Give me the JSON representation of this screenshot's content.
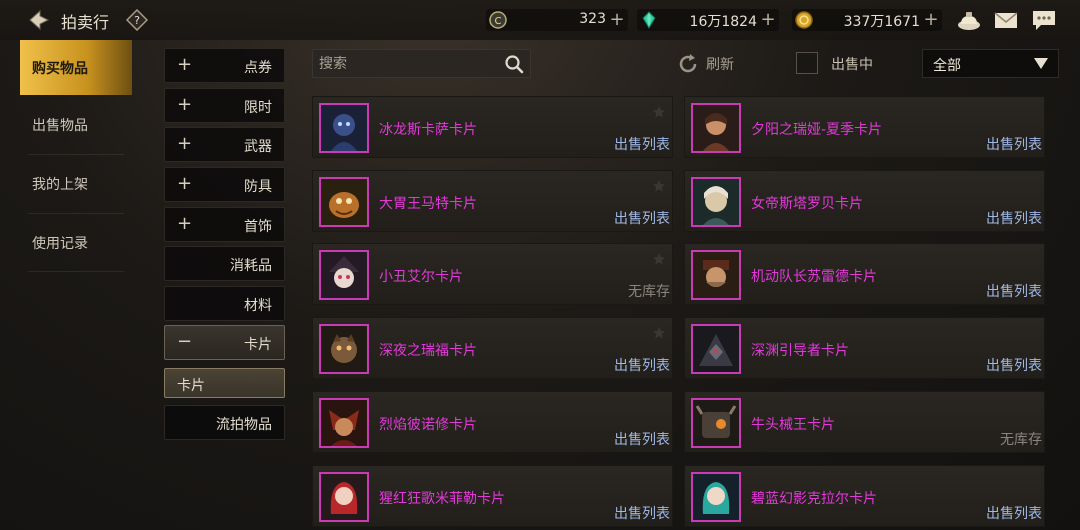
{
  "app": {
    "title": "拍卖行"
  },
  "currencies": [
    {
      "icon": "coin-c-icon",
      "value": "323"
    },
    {
      "icon": "gem-icon",
      "value": "16万1824"
    },
    {
      "icon": "gold-icon",
      "value": "337万1671"
    }
  ],
  "colors": {
    "accent_gold": "#f0c14a",
    "rarity_purple": "#e23ad8",
    "status_blue": "#9fb8e6",
    "status_gray": "#8a857c"
  },
  "nav": {
    "items": [
      {
        "label": "购买物品",
        "active": true
      },
      {
        "label": "出售物品",
        "active": false
      },
      {
        "label": "我的上架",
        "active": false
      },
      {
        "label": "使用记录",
        "active": false
      }
    ]
  },
  "categories": [
    {
      "sign": "+",
      "label": "点券"
    },
    {
      "sign": "+",
      "label": "限时"
    },
    {
      "sign": "+",
      "label": "武器"
    },
    {
      "sign": "+",
      "label": "防具"
    },
    {
      "sign": "+",
      "label": "首饰"
    },
    {
      "sign": "",
      "label": "消耗品"
    },
    {
      "sign": "",
      "label": "材料"
    },
    {
      "sign": "−",
      "label": "卡片"
    },
    {
      "sign": "",
      "label": "卡片"
    },
    {
      "sign": "",
      "label": "流拍物品"
    }
  ],
  "search": {
    "placeholder": "搜索",
    "value": ""
  },
  "refresh": {
    "label": "刷新"
  },
  "on_sale": {
    "label": "出售中",
    "checked": false
  },
  "filter": {
    "selected": "全部"
  },
  "cards": [
    {
      "name": "冰龙斯卡萨卡片",
      "status": "出售列表"
    },
    {
      "name": "夕阳之瑞娅-夏季卡片",
      "status": "出售列表"
    },
    {
      "name": "大胃王马特卡片",
      "status": "出售列表"
    },
    {
      "name": "女帝斯塔罗贝卡片",
      "status": "出售列表"
    },
    {
      "name": "小丑艾尔卡片",
      "status": "无库存"
    },
    {
      "name": "机动队长苏雷德卡片",
      "status": "出售列表"
    },
    {
      "name": "深夜之瑞福卡片",
      "status": "出售列表"
    },
    {
      "name": "深渊引导者卡片",
      "status": "出售列表"
    },
    {
      "name": "烈焰彼诺修卡片",
      "status": "出售列表"
    },
    {
      "name": "牛头械王卡片",
      "status": "无库存"
    },
    {
      "name": "猩红狂歌米菲勒卡片",
      "status": "出售列表"
    },
    {
      "name": "碧蓝幻影克拉尔卡片",
      "status": "出售列表"
    }
  ]
}
